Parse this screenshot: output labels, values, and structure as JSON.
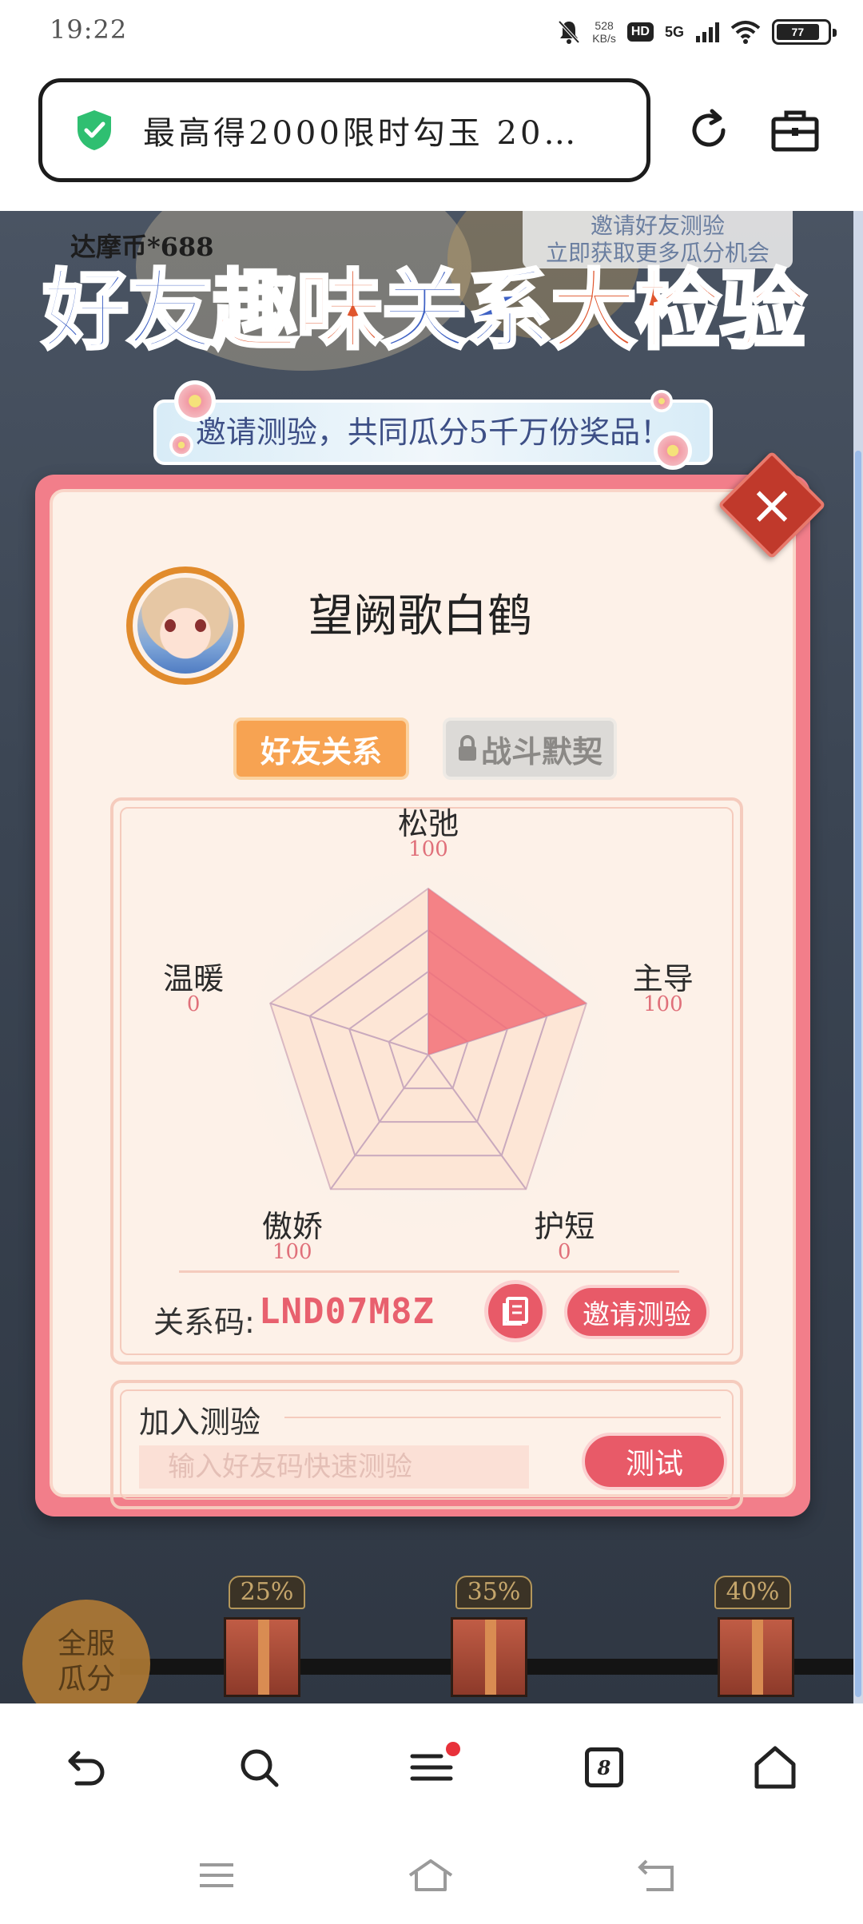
{
  "status_bar": {
    "time": "19:22",
    "net_speed_value": "528",
    "net_speed_unit": "KB/s",
    "hd": "HD",
    "network": "5G",
    "battery": "77"
  },
  "address_bar": {
    "url_text": "最高得2000限时勾玉 20…"
  },
  "page": {
    "coin_text": "达摩币*688",
    "invite_tip_line1": "邀请好友测验",
    "invite_tip_line2": "立即获取更多瓜分机会",
    "title_part1": "好友",
    "title_part2": "趣味",
    "title_part3": "关系",
    "title_part4": "大检验",
    "subtitle": "邀请测验，共同瓜分5千万份奖品！"
  },
  "modal": {
    "player_name": "望阙歌白鹤",
    "tabs": [
      {
        "label": "好友关系",
        "active": true
      },
      {
        "label": "战斗默契",
        "locked": true
      }
    ],
    "radar": {
      "axes": [
        {
          "label": "松弛",
          "value": 100
        },
        {
          "label": "主导",
          "value": 100
        },
        {
          "label": "护短",
          "value": 0
        },
        {
          "label": "傲娇",
          "value": 100
        },
        {
          "label": "温暖",
          "value": 0
        }
      ],
      "value_labels": [
        "100",
        "100",
        "0",
        "100",
        "0"
      ],
      "max": 100,
      "fill_color": "#f27078"
    },
    "relation_code_label": "关系码:",
    "relation_code": "LND07M8Z",
    "invite_button": "邀请测验",
    "join_title": "加入测验",
    "join_placeholder": "输入好友码快速测验",
    "test_button": "测试"
  },
  "progress": {
    "server_share_line1": "全服",
    "server_share_line2": "瓜分",
    "milestones": [
      "25%",
      "35%",
      "40%"
    ]
  },
  "bottom_nav": {
    "tab_count": "8"
  },
  "colors": {
    "accent_pink": "#e85a68",
    "tab_orange": "#f7a352",
    "modal_border": "#f27e8a"
  }
}
